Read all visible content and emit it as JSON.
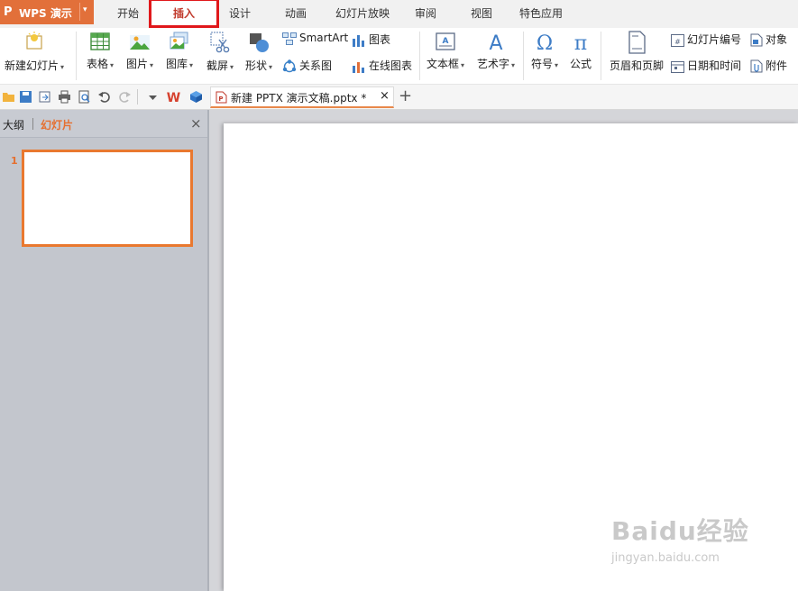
{
  "app": {
    "name": "WPS 演示",
    "logo_char": "P"
  },
  "tabs": [
    {
      "label": "开始"
    },
    {
      "label": "插入"
    },
    {
      "label": "设计"
    },
    {
      "label": "动画"
    },
    {
      "label": "幻灯片放映"
    },
    {
      "label": "审阅"
    },
    {
      "label": "视图"
    },
    {
      "label": "特色应用"
    }
  ],
  "active_tab": "插入",
  "ribbon": {
    "new_slide": "新建幻灯片",
    "table": "表格",
    "picture": "图片",
    "gallery": "图库",
    "screenshot": "截屏",
    "shapes": "形状",
    "smartart": "SmartArt",
    "relation": "关系图",
    "chart": "图表",
    "online_chart": "在线图表",
    "textbox": "文本框",
    "wordart": "艺术字",
    "symbol": "符号",
    "formula": "公式",
    "header_footer": "页眉和页脚",
    "slide_number": "幻灯片编号",
    "datetime": "日期和时间",
    "object": "对象",
    "attachment": "附件"
  },
  "document_tab": {
    "title": "新建 PPTX 演示文稿.pptx *",
    "close": "×",
    "new_tab": "+"
  },
  "left_panel": {
    "tab_outline": "大纲",
    "tab_slides": "幻灯片",
    "close": "×",
    "thumb_number": "1"
  },
  "watermark": {
    "main": "Baidu经验",
    "sub": "jingyan.baidu.com"
  },
  "colors": {
    "accent": "#e2703a",
    "highlight": "#e0181b",
    "panel": "#c3c6cd"
  }
}
